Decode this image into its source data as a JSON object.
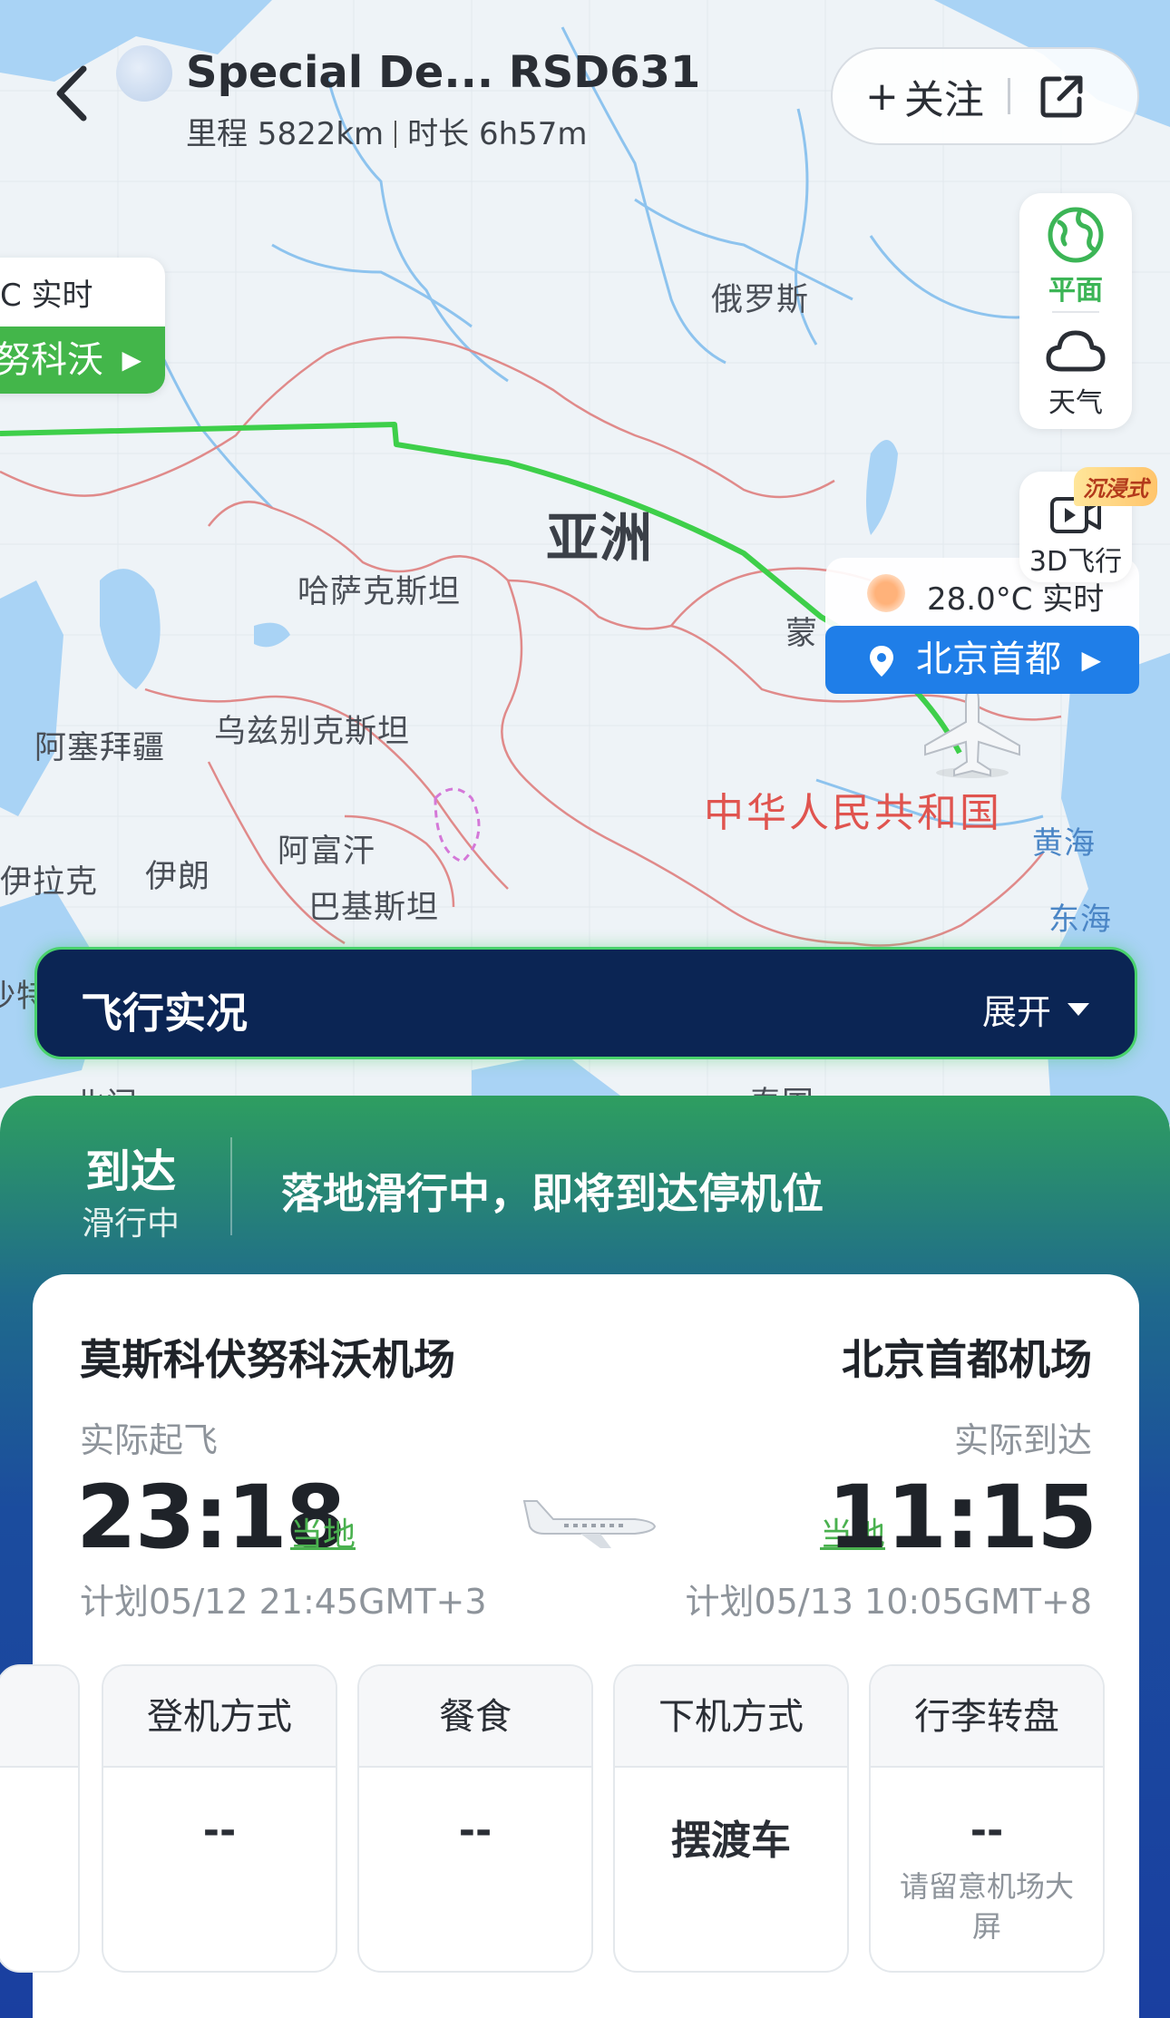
{
  "header": {
    "flight_title": "Special De... RSD631",
    "distance": "里程 5822km",
    "duration": "时长 6h57m",
    "follow_label": "关注"
  },
  "map": {
    "tools": {
      "flat_label": "平面",
      "weather_label": "天气",
      "flight3d_label": "3D飞行",
      "immersive_badge": "沉浸式"
    },
    "labels": {
      "russia": "俄罗斯",
      "asia": "亚洲",
      "kazakhstan": "哈萨克斯坦",
      "mongolia": "蒙",
      "azerbaijan": "阿塞拜疆",
      "uzbekistan": "乌兹别克斯坦",
      "afghanistan": "阿富汗",
      "iraq": "伊拉克",
      "iran": "伊朗",
      "pakistan": "巴基斯坦",
      "china": "中华人民共和国",
      "yellow_sea": "黄海",
      "east_sea": "东海",
      "edge_left": "沙特",
      "edge_bottom_left": "北门",
      "edge_bottom_right": "泰国"
    },
    "departure": {
      "weather": "C 实时",
      "city": "努科沃"
    },
    "arrival": {
      "weather": "28.0°C 实时",
      "city": "北京首都"
    },
    "colors": {
      "route": "#3ecf4a",
      "border": "#e08a8a"
    }
  },
  "live": {
    "title": "飞行实况",
    "expand_label": "展开"
  },
  "status": {
    "main": "到达",
    "sub": "滑行中",
    "message": "落地滑行中，即将到达停机位"
  },
  "flight": {
    "from_airport": "莫斯科伏努科沃机场",
    "to_airport": "北京首都机场",
    "dep_label": "实际起飞",
    "arr_label": "实际到达",
    "dep_time": "23:18",
    "arr_time": "11:15",
    "local_tag": "当地",
    "dep_plan": "计划05/12 21:45GMT+3",
    "arr_plan": "计划05/13 10:05GMT+8"
  },
  "tiles": [
    {
      "head": "登机方式",
      "value": "--",
      "note": ""
    },
    {
      "head": "餐食",
      "value": "--",
      "note": ""
    },
    {
      "head": "下机方式",
      "value": "摆渡车",
      "note": ""
    },
    {
      "head": "行李转盘",
      "value": "--",
      "note": "请留意机场大屏"
    }
  ]
}
